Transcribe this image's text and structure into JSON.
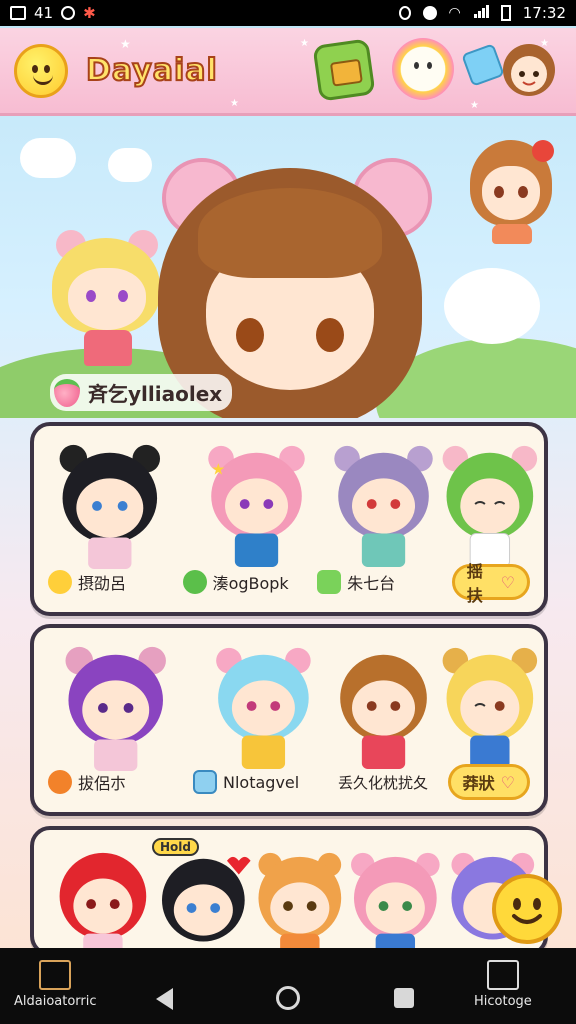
{
  "status_bar": {
    "left_text": "41",
    "time": "17:32"
  },
  "header": {
    "title": "Dayaial"
  },
  "hero": {
    "label": "斉乞ylliaolex"
  },
  "panels": [
    {
      "footer": [
        {
          "icon": "chick-icon",
          "label": "摂劭呂"
        },
        {
          "icon": "apple-icon",
          "label": "湊ogBopk"
        },
        {
          "icon": "leaf-icon",
          "label": "朱七台"
        }
      ],
      "button_label": "揺扶"
    },
    {
      "footer": [
        {
          "icon": "orange-icon",
          "label": "拔侶朩"
        },
        {
          "icon": "box-icon",
          "label": "Nlotagvel"
        }
      ],
      "footer_text": "丢久化枕扰夂",
      "button_label": "莽狀"
    },
    {
      "badge": "Hold"
    }
  ],
  "nav": {
    "left_label": "Aldaioatorric",
    "right_label": "Hicotoge"
  },
  "colors": {
    "header_pink": "#f7bcd2",
    "panel_border": "#3c3344",
    "pill_yellow": "#ffe066"
  }
}
